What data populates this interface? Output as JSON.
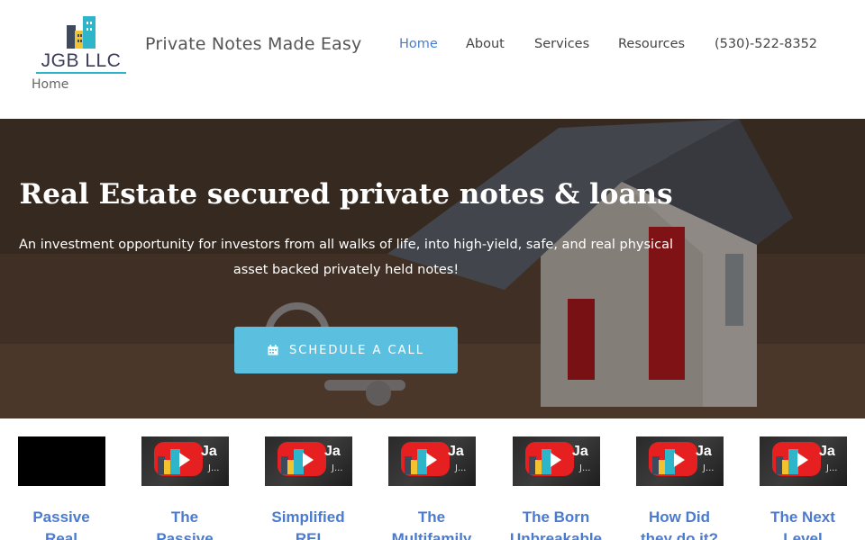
{
  "header": {
    "logo_text": "JGB LLC",
    "site_title": "Private Notes Made Easy",
    "nav": [
      {
        "label": "Home",
        "active": true
      },
      {
        "label": "About",
        "active": false
      },
      {
        "label": "Services",
        "active": false
      },
      {
        "label": "Resources",
        "active": false
      },
      {
        "label": "(530)-522-8352",
        "active": false
      }
    ],
    "breadcrumb": "Home"
  },
  "hero": {
    "title": "Real Estate secured private notes & loans",
    "subtitle_line1": "An investment opportunity for investors from all walks of life, into high-yield, safe, and real physical",
    "subtitle_line2": "asset backed privately held notes!",
    "cta_label": "SCHEDULE A CALL",
    "cta_icon": "calendar-icon"
  },
  "videos": [
    {
      "title_line1": "Passive",
      "title_line2": "Real",
      "thumb_text": "",
      "thumb_sub": "",
      "thumb_style": "blank"
    },
    {
      "title_line1": "The",
      "title_line2": "Passive",
      "thumb_text": "Ja",
      "thumb_sub": "J...",
      "thumb_style": "youtube"
    },
    {
      "title_line1": "Simplified",
      "title_line2": "REI",
      "thumb_text": "Ja",
      "thumb_sub": "J...",
      "thumb_style": "youtube"
    },
    {
      "title_line1": "The",
      "title_line2": "Multifamily",
      "thumb_text": "Ja",
      "thumb_sub": "J...",
      "thumb_style": "youtube"
    },
    {
      "title_line1": "The Born",
      "title_line2": "Unbreakable",
      "thumb_text": "Ja",
      "thumb_sub": "J...",
      "thumb_style": "youtube"
    },
    {
      "title_line1": "How Did",
      "title_line2": "they do it?",
      "thumb_text": "Ja",
      "thumb_sub": "J...",
      "thumb_style": "youtube"
    },
    {
      "title_line1": "The Next",
      "title_line2": "Level",
      "thumb_text": "Ja",
      "thumb_sub": "J...",
      "thumb_style": "youtube"
    }
  ],
  "colors": {
    "accent_link": "#4a7bd0",
    "cta_bg": "#5bc0e0",
    "youtube_red": "#e62021",
    "logo_teal": "#2fb5c9",
    "logo_yellow": "#f2c230"
  }
}
